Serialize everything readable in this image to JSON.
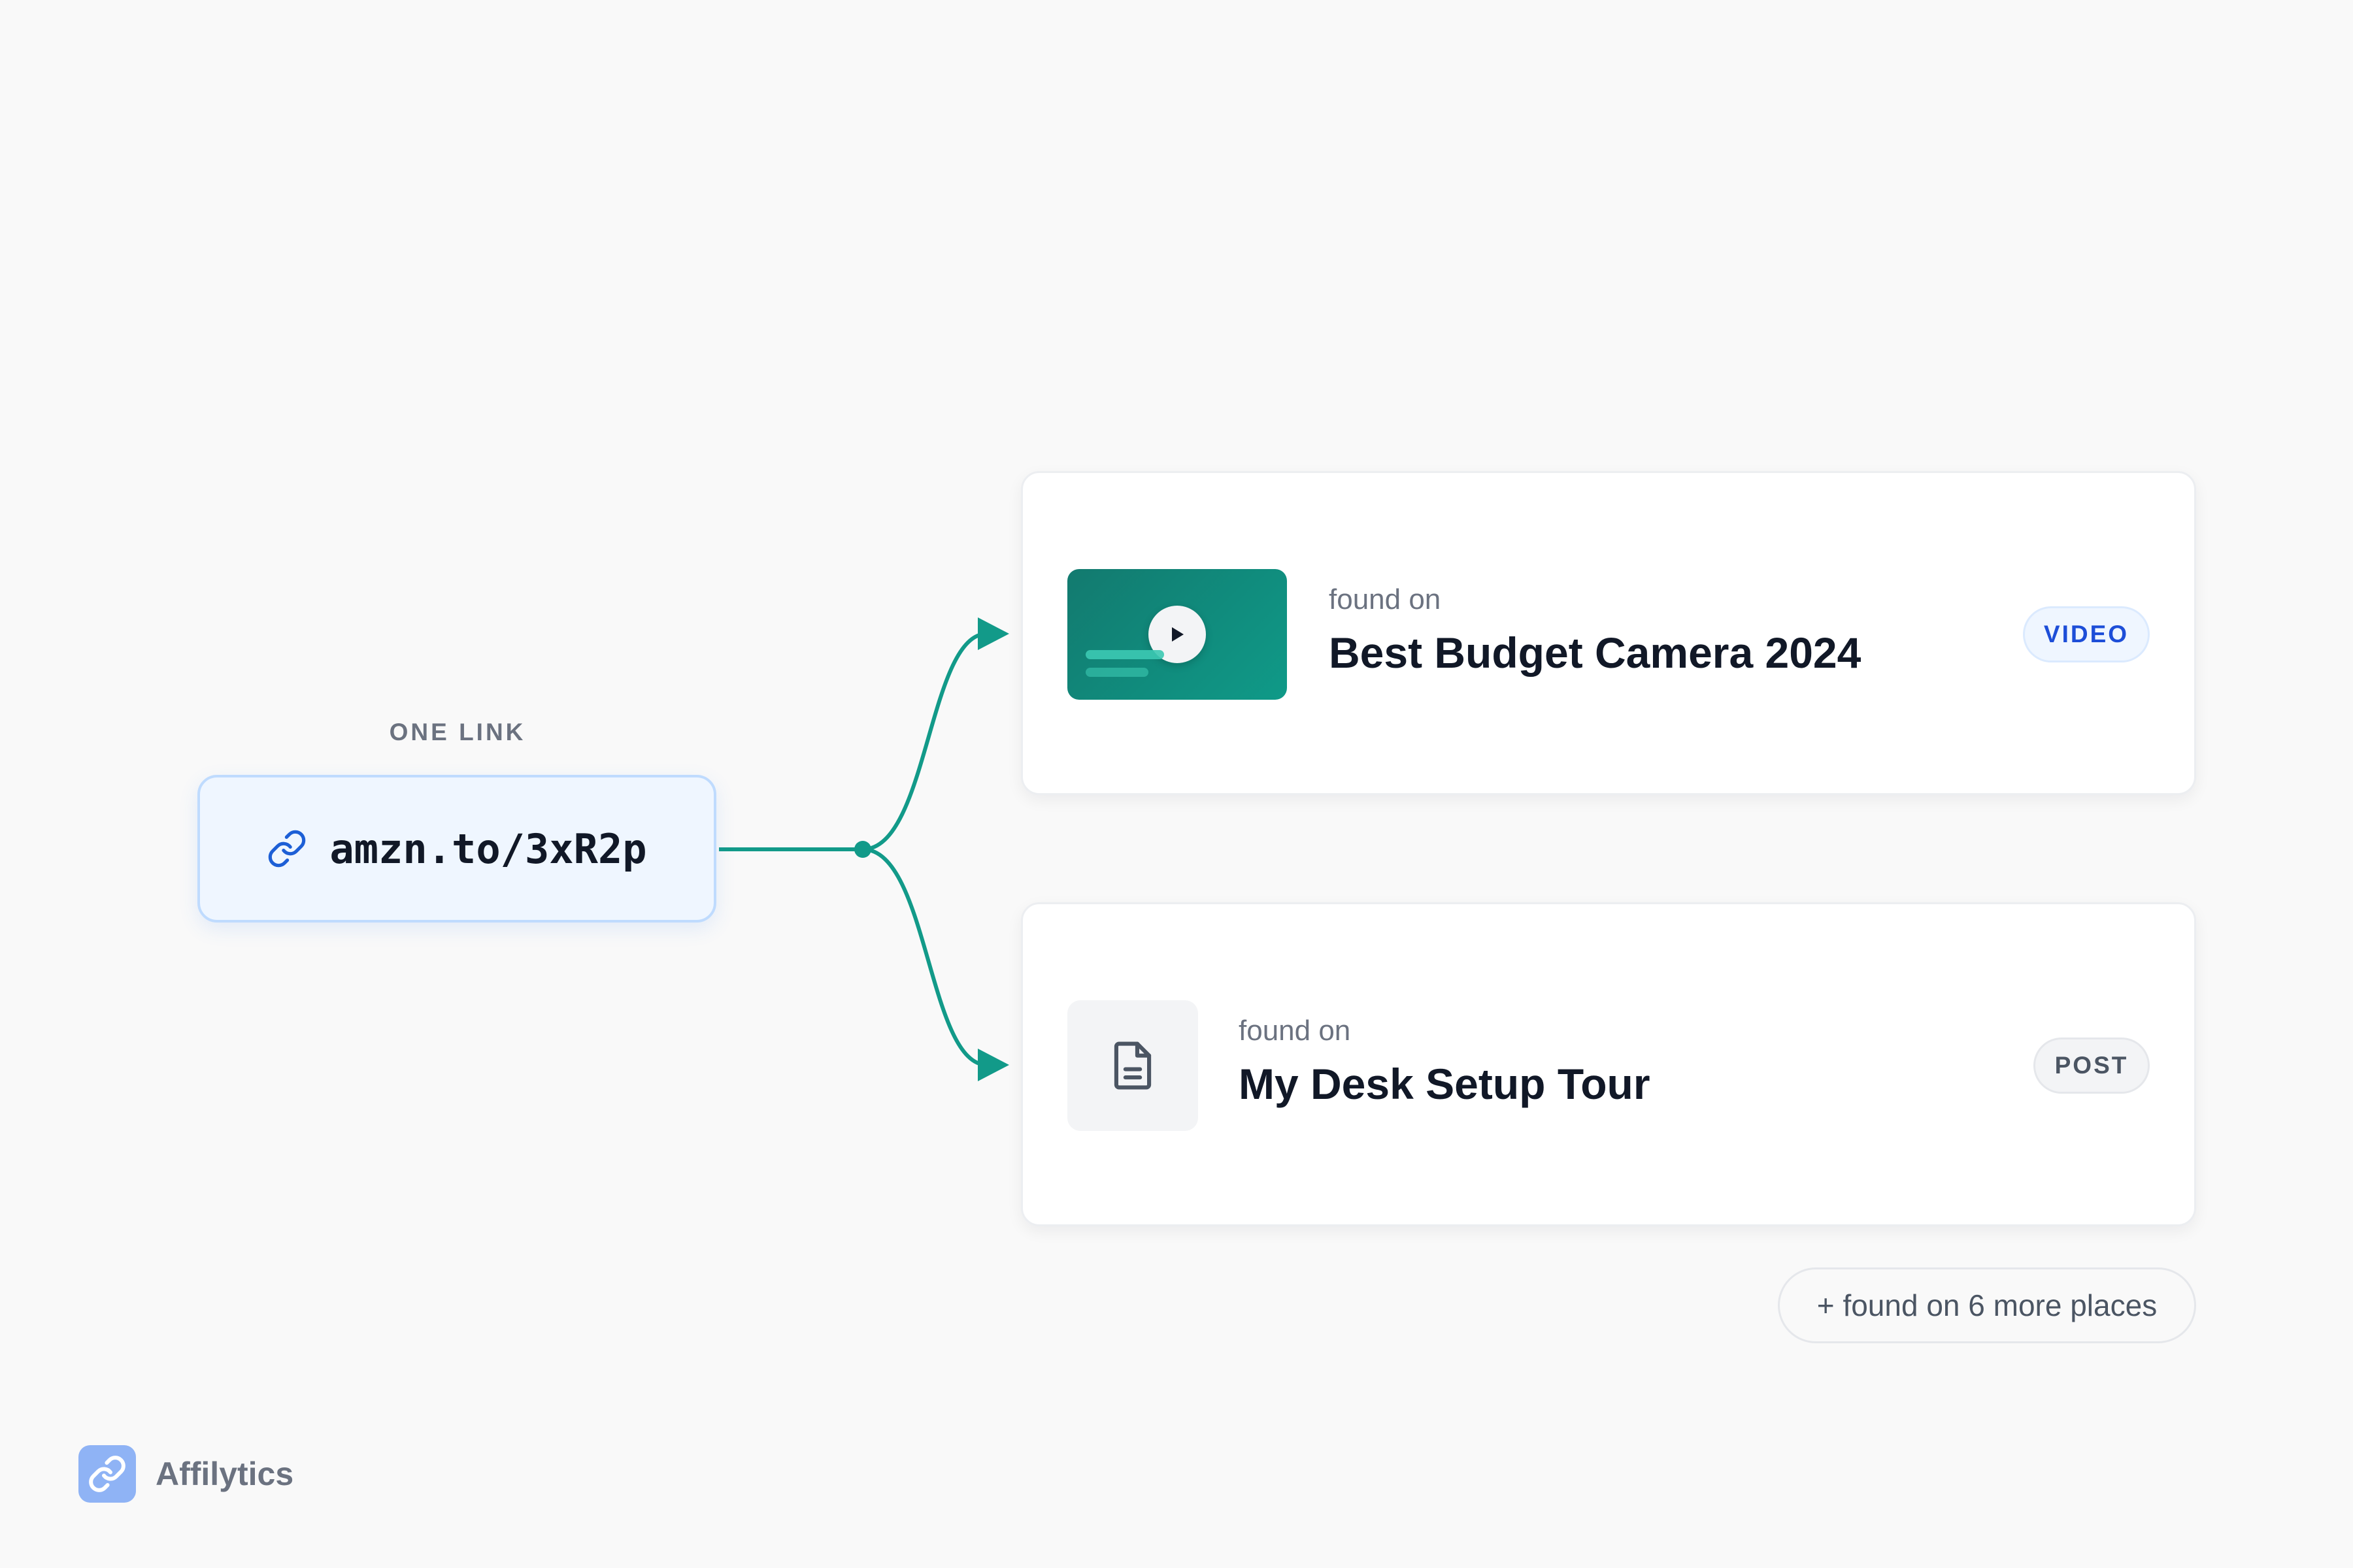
{
  "source": {
    "label": "ONE LINK",
    "url": "amzn.to/3xR2p",
    "icon": "link-icon"
  },
  "destinations": [
    {
      "found_on_label": "found on",
      "title": "Best Budget Camera 2024",
      "badge": "VIDEO",
      "thumbnail": "video-thumbnail-play-icon"
    },
    {
      "found_on_label": "found on",
      "title": "My Desk Setup Tour",
      "badge": "POST",
      "thumbnail": "document-icon"
    }
  ],
  "more_places": "+ found on 6 more places",
  "brand": {
    "name": "Affilytics",
    "icon": "link-logo-icon"
  },
  "colors": {
    "connector": "#129a89",
    "link_box_bg": "#eff6ff",
    "link_box_border": "#bfdbfe",
    "video_badge_text": "#1d4ed8",
    "brand_logo": "#8fb3f5"
  }
}
